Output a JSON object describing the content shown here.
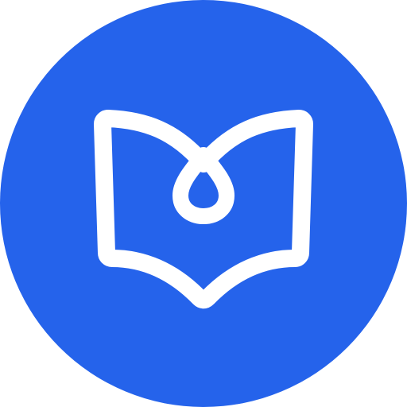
{
  "icon": {
    "name": "open-book-with-drop",
    "background_color": "#2563EB",
    "foreground_color": "#FFFFFF"
  }
}
